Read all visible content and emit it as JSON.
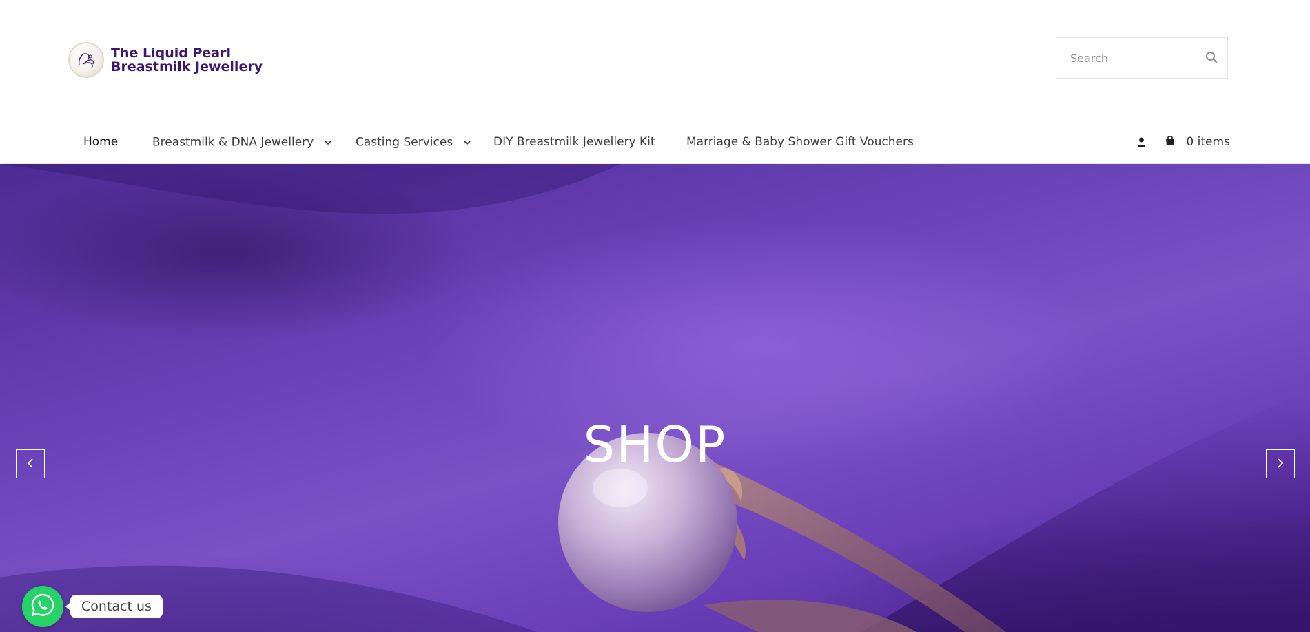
{
  "brand": {
    "name_line1": "The Liquid Pearl",
    "name_line2": "Breastmilk Jewellery",
    "logo_icon": "pearl-logo-icon",
    "color": "#3c1674"
  },
  "search": {
    "placeholder": "Search",
    "value": "",
    "icon": "search-icon"
  },
  "nav": {
    "items": [
      {
        "label": "Home",
        "has_dropdown": false
      },
      {
        "label": "Breastmilk & DNA Jewellery",
        "has_dropdown": true
      },
      {
        "label": "Casting Services",
        "has_dropdown": true
      },
      {
        "label": "DIY Breastmilk Jewellery Kit",
        "has_dropdown": false
      },
      {
        "label": "Marriage & Baby Shower Gift Vouchers",
        "has_dropdown": false
      }
    ],
    "account_icon": "user-icon",
    "cart": {
      "icon": "shopping-bag-icon",
      "label": "0 items"
    }
  },
  "hero": {
    "title": "SHOP",
    "prev_icon": "chevron-left-icon",
    "next_icon": "chevron-right-icon",
    "accent_color": "#6a42b8"
  },
  "whatsapp": {
    "icon": "whatsapp-icon",
    "label": "Contact us",
    "color": "#25d366"
  }
}
